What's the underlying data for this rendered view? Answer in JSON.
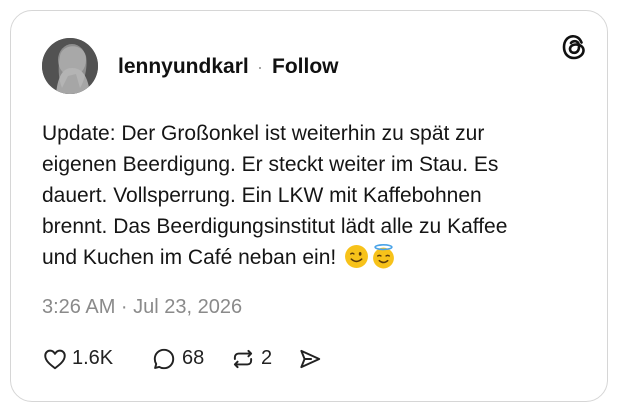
{
  "post": {
    "username": "lennyundkarl",
    "separator": "·",
    "follow_label": "Follow",
    "text_lines": [
      "Update: Der Großonkel ist weiterhin zu spät zur",
      "eigenen Beerdigung. Er steckt weiter im Stau. Es",
      "dauert. Vollsperrung. Ein LKW mit Kaffebohnen",
      "brennt. Das Beerdigungsinstitut lädt  alle zu Kaffee",
      "und Kuchen im Café neban ein!"
    ],
    "emojis": [
      "winking-face-emoji",
      "smiling-face-with-halo-emoji"
    ],
    "timestamp": "3:26 AM · Jul 23, 2026"
  },
  "actions": {
    "like_count": "1.6K",
    "reply_count": "68",
    "repost_count": "2"
  },
  "icons": [
    "threads-logo-icon",
    "heart-icon",
    "reply-icon",
    "repost-icon",
    "share-icon"
  ],
  "colors": {
    "text": "#111111",
    "muted": "#8a8a8a",
    "border": "#d6d6d6",
    "emoji": "#f7c21a"
  }
}
